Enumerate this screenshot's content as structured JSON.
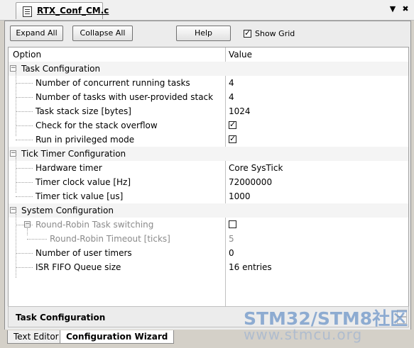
{
  "document_tab": {
    "title": "RTX_Conf_CM.c"
  },
  "window_controls": {
    "dropdown": "▼",
    "close": "✖"
  },
  "toolbar": {
    "expand_all": "Expand All",
    "collapse_all": "Collapse All",
    "help": "Help",
    "show_grid": "Show Grid",
    "show_grid_checked": true
  },
  "columns": {
    "option": "Option",
    "value": "Value"
  },
  "rows": [
    {
      "option": "Task Configuration",
      "value": "",
      "type": "group",
      "expander": "−"
    },
    {
      "option": "Number of concurrent running tasks",
      "value": "4"
    },
    {
      "option": "Number of tasks with user-provided stack",
      "value": "4"
    },
    {
      "option": "Task stack size [bytes]",
      "value": "1024"
    },
    {
      "option": "Check for the stack overflow",
      "value": "",
      "checkbox": true,
      "checked": true
    },
    {
      "option": "Run in privileged mode",
      "value": "",
      "checkbox": true,
      "checked": true
    },
    {
      "option": "Tick Timer Configuration",
      "value": "",
      "type": "group",
      "expander": "−"
    },
    {
      "option": "Hardware timer",
      "value": "Core SysTick"
    },
    {
      "option": "Timer clock value [Hz]",
      "value": "72000000"
    },
    {
      "option": "Timer tick value [us]",
      "value": "1000"
    },
    {
      "option": "System Configuration",
      "value": "",
      "type": "group",
      "expander": "−"
    },
    {
      "option": "Round-Robin Task switching",
      "value": "",
      "checkbox": true,
      "checked": false,
      "disabled": true,
      "expander": "−"
    },
    {
      "option": "Round-Robin Timeout [ticks]",
      "value": "5",
      "disabled": true
    },
    {
      "option": "Number of user timers",
      "value": "0"
    },
    {
      "option": "ISR FIFO Queue size",
      "value": "16 entries"
    }
  ],
  "description": {
    "title": "Task Configuration"
  },
  "bottom_tabs": [
    {
      "label": "Text Editor",
      "active": false
    },
    {
      "label": "Configuration Wizard",
      "active": true
    }
  ],
  "watermark": {
    "line1": "STM32/STM8社区",
    "line2": "www.stmcu.org"
  }
}
